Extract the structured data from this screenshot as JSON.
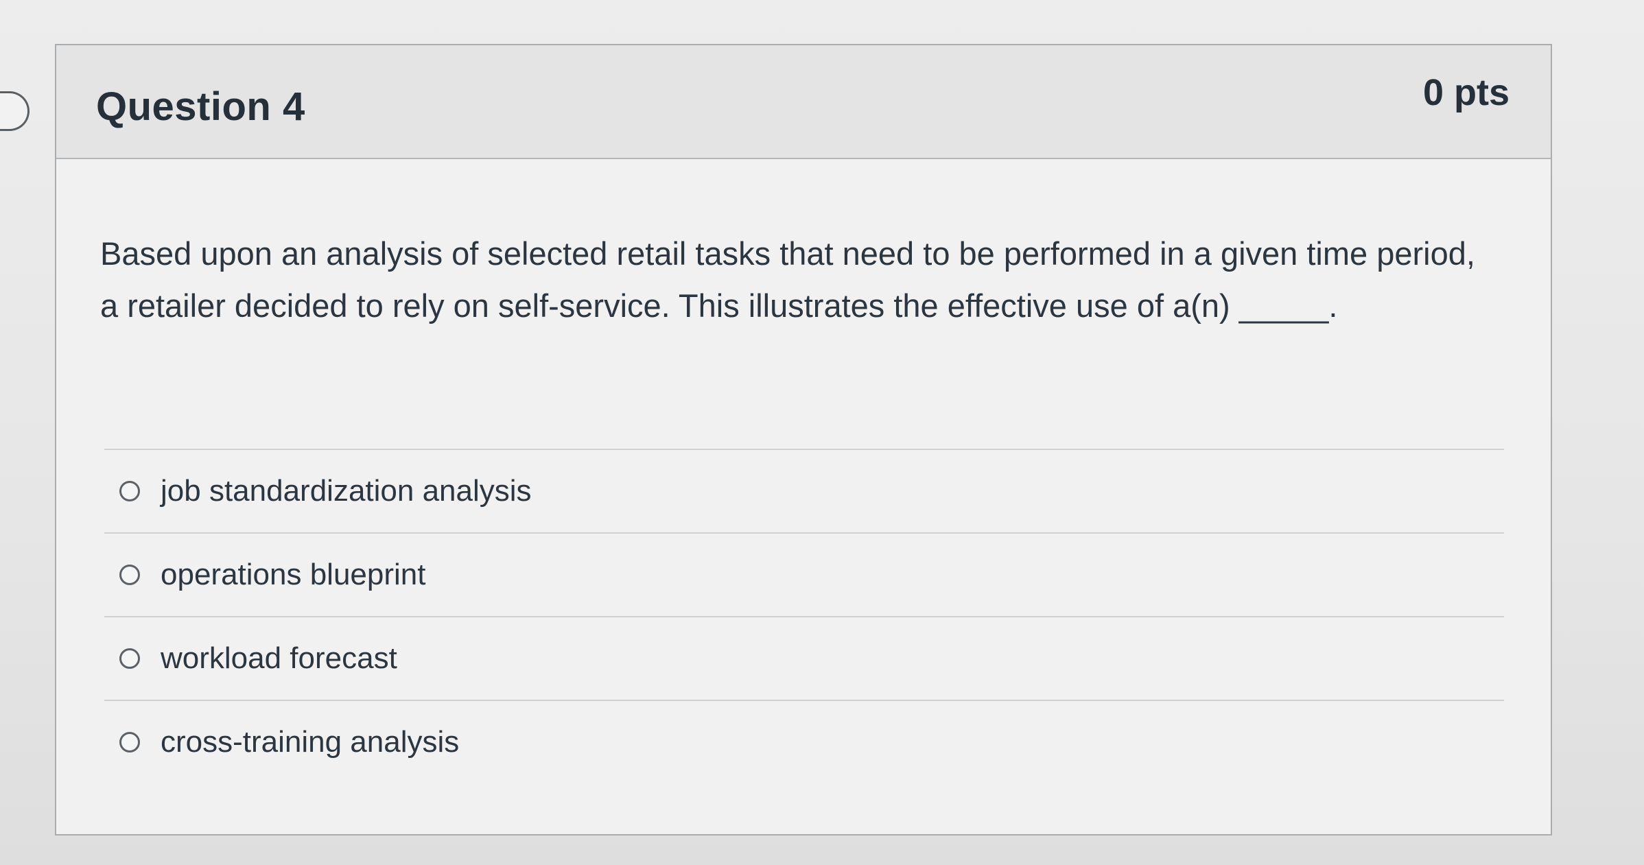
{
  "question": {
    "title": "Question 4",
    "points": "0 pts",
    "text": "Based upon an analysis of selected retail tasks that need to be performed in a given time period, a retailer decided to rely on self-service. This illustrates the effective use of a(n) _____.",
    "answers": [
      {
        "label": "job standardization analysis"
      },
      {
        "label": "operations blueprint"
      },
      {
        "label": "workload forecast"
      },
      {
        "label": "cross-training analysis"
      }
    ]
  },
  "icons": {
    "flag": "flag-marker-icon",
    "radio": "radio-button-icon"
  },
  "colors": {
    "header_bg": "#e4e4e4",
    "card_bg": "#f1f1f1",
    "text": "#2b3640",
    "border": "#a9adb0"
  }
}
